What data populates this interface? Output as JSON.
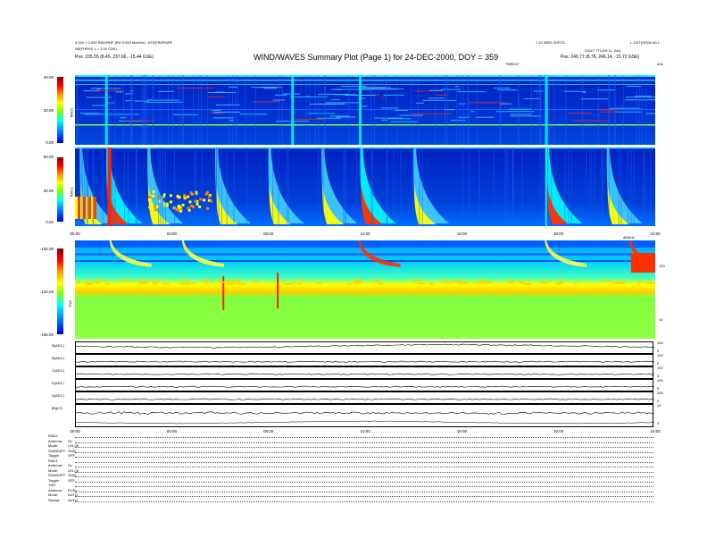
{
  "header": {
    "title": "WIND/WAVES Summary Plot (Page 1) for 24-DEC-2000, DOY = 359",
    "left_line1": "0.020 > 0.000 RAD/RHF (RH 0.000 Mz/kHz) : ATS(FB/RH)RF",
    "left_line2": "AB(FHRSS 1 = 1.00 CDE)",
    "left_pos": "Pos: 235.55 (8.45, 237.66, -15.44 GSE)",
    "right_line1": "1.10 WED 01/FCD",
    "right_line2": "DAILY TTL(09:11, 2xx)",
    "right_pos": "Pos: 246.77 (8.78, 246.14, -15.72 GSE)",
    "right_corner": "L.3.ET(OD)N.ci0.1",
    "ut_label": "TIME/UT",
    "khz": "kHz"
  },
  "rad2": {
    "label": "RAD2",
    "ticks": [
      "40.00",
      "20.00",
      "0.00"
    ]
  },
  "rad1": {
    "label": "RAD1",
    "ticks": [
      "60.00",
      "30.00",
      "0.00"
    ],
    "time_ticks": [
      "00:00",
      "04:00",
      "08:00",
      "12:00",
      "16:00",
      "20:00",
      "24:00"
    ]
  },
  "tnr": {
    "label": "TNR",
    "ticks": [
      "-125.00",
      "-140.00",
      "-155.00"
    ],
    "right_ticks": [
      "100",
      "10"
    ],
    "units": "dB/kHz"
  },
  "lines": [
    {
      "label": "B(ADC)",
      "rticks": [
        "100",
        "0"
      ]
    },
    {
      "label": "B(ADC)",
      "rticks": [
        "100",
        "0"
      ]
    },
    {
      "label": "C(ADC)",
      "rticks": [
        "100",
        "0"
      ]
    },
    {
      "label": "E(ADC)",
      "rticks": [
        "100",
        "0"
      ]
    },
    {
      "label": "A(ADC)",
      "rticks": [
        "100",
        "0"
      ]
    },
    {
      "label": "|B|(nT)",
      "rticks": [
        "10",
        "0"
      ]
    }
  ],
  "bottom_time_ticks": [
    "00:00",
    "04:00",
    "08:00",
    "12:00",
    "16:00",
    "20:00",
    "24:00"
  ],
  "settings": [
    {
      "k": "RAD2",
      "v": ""
    },
    {
      "k": "Antenna:",
      "v": "Sx"
    },
    {
      "k": "Mode:",
      "v": "LIN (3)"
    },
    {
      "k": "SUM/DIFF:",
      "v": "SUM"
    },
    {
      "k": "Toggle:",
      "v": "OFF"
    },
    {
      "k": "RAD1",
      "v": ""
    },
    {
      "k": "Antenna:",
      "v": "Sx"
    },
    {
      "k": "Mode:",
      "v": "LIN (3)"
    },
    {
      "k": "SUM/DIFF:",
      "v": "SUM"
    },
    {
      "k": "Toggle:",
      "v": "OFF"
    },
    {
      "k": "TNR",
      "v": ""
    },
    {
      "k": "Antenna:",
      "v": "Ex/Ey"
    },
    {
      "k": "Mode:",
      "v": "AUTO"
    },
    {
      "k": "Sweep:",
      "v": "AUTO"
    }
  ],
  "chart_data": {
    "type": "heatmap",
    "title": "WIND/WAVES Summary Plot (Page 1) for 24-DEC-2000, DOY = 359",
    "xlabel": "TIME/UT",
    "x_range_hours": [
      0,
      24
    ],
    "panels": [
      {
        "name": "RAD2",
        "ylim": [
          0,
          40
        ],
        "events_hours": [
          1.3,
          9.0,
          11.8,
          19.5
        ]
      },
      {
        "name": "RAD1",
        "ylim": [
          0,
          60
        ],
        "events_hours": [
          0.2,
          1.3,
          3.0,
          5.8,
          8.0,
          10.2,
          11.8,
          14.0,
          19.5,
          22.0
        ]
      },
      {
        "name": "TNR",
        "ylim": [
          -155,
          -125
        ],
        "events_hours": [
          1.5,
          4.5,
          11.8,
          19.5,
          23.0
        ]
      }
    ]
  }
}
